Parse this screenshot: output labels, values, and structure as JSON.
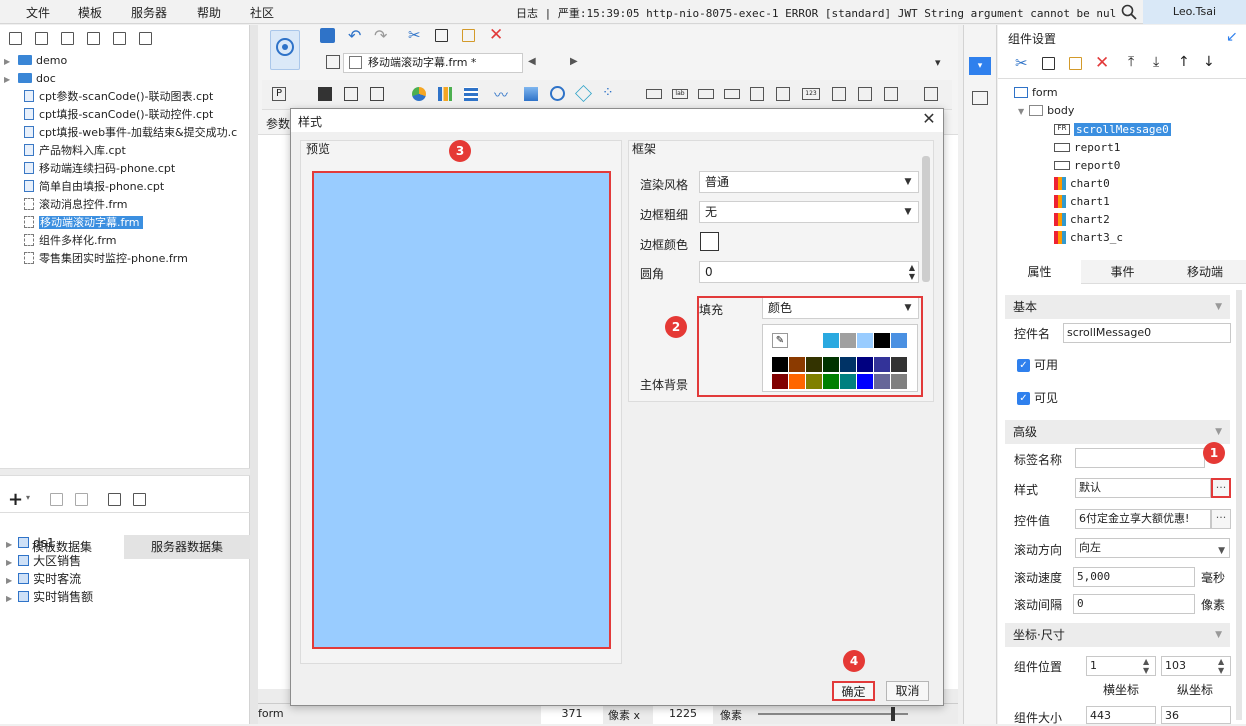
{
  "menubar": {
    "items": [
      "文件",
      "模板",
      "服务器",
      "帮助",
      "社区"
    ],
    "log_text": "日志 | 严重:15:39:05 http-nio-8075-exec-1 ERROR [standard] JWT String argument cannot be null or ...",
    "user": "Leo.Tsai"
  },
  "file_tree": {
    "folders": [
      "demo",
      "doc"
    ],
    "files": [
      "cpt参数-scanCode()-联动图表.cpt",
      "cpt填报-scanCode()-联动控件.cpt",
      "cpt填报-web事件-加载结束&提交成功.c",
      "产品物料入库.cpt",
      "移动端连续扫码-phone.cpt",
      "简单自由填报-phone.cpt",
      "滚动消息控件.frm",
      "移动端滚动字幕.frm",
      "组件多样化.frm",
      "零售集团实时监控-phone.frm"
    ],
    "selected": "移动端滚动字幕.frm"
  },
  "datasets": {
    "tabs": [
      "模板数据集",
      "服务器数据集"
    ],
    "items": [
      "ds1",
      "大区销售",
      "实时客流",
      "实时销售额"
    ]
  },
  "editor": {
    "tab_title": "移动端滚动字幕.frm *",
    "param_label": "参数",
    "status_form": "form",
    "x_value": "371",
    "x_unit": "像素 x",
    "y_value": "1225",
    "y_unit": "像素"
  },
  "dialog": {
    "title": "样式",
    "preview_label": "预览",
    "frame_label": "框架",
    "render_style_label": "渲染风格",
    "render_style_value": "普通",
    "border_width_label": "边框粗细",
    "border_width_value": "无",
    "border_color_label": "边框颜色",
    "radius_label": "圆角",
    "radius_value": "0",
    "fill_label": "填充",
    "fill_value": "颜色",
    "body_bg_label": "主体背景",
    "ok": "确定",
    "cancel": "取消",
    "preview_color": "#99ccff",
    "palette_row1": [
      "#ffffff",
      "#2aa9e0",
      "#a0a0a0",
      "#99ccff",
      "#000000",
      "#4a90e2"
    ],
    "palette_row2": [
      "#000000",
      "#8b3a00",
      "#333300",
      "#003300",
      "#003366",
      "#000080",
      "#333399",
      "#333333"
    ],
    "palette_row3": [
      "#800000",
      "#ff6600",
      "#808000",
      "#008000",
      "#008080",
      "#0000ff",
      "#666699",
      "#808080"
    ]
  },
  "component_panel": {
    "title": "组件设置",
    "tree": {
      "root": "form",
      "body": "body",
      "widgets": [
        "scrollMessage0",
        "report1",
        "report0",
        "chart0",
        "chart1",
        "chart2",
        "chart3_c"
      ]
    },
    "tabs": [
      "属性",
      "事件",
      "移动端"
    ],
    "sections": {
      "basic": "基本",
      "advanced": "高级",
      "coords": "坐标·尺寸"
    },
    "widget_name_label": "控件名",
    "widget_name": "scrollMessage0",
    "enabled_label": "可用",
    "visible_label": "可见",
    "tag_label": "标签名称",
    "style_label": "样式",
    "style_value": "默认",
    "value_label": "控件值",
    "value_text": "6付定金立享大额优惠!",
    "direction_label": "滚动方向",
    "direction_value": "向左",
    "speed_label": "滚动速度",
    "speed_value": "5,000",
    "speed_unit": "毫秒",
    "interval_label": "滚动间隔",
    "interval_value": "0",
    "interval_unit": "像素",
    "position_label": "组件位置",
    "pos_x": "1",
    "pos_y": "103",
    "x_caption": "横坐标",
    "y_caption": "纵坐标",
    "size_label": "组件大小",
    "size_w": "443",
    "size_h": "36"
  },
  "badges": [
    "1",
    "2",
    "3",
    "4"
  ]
}
